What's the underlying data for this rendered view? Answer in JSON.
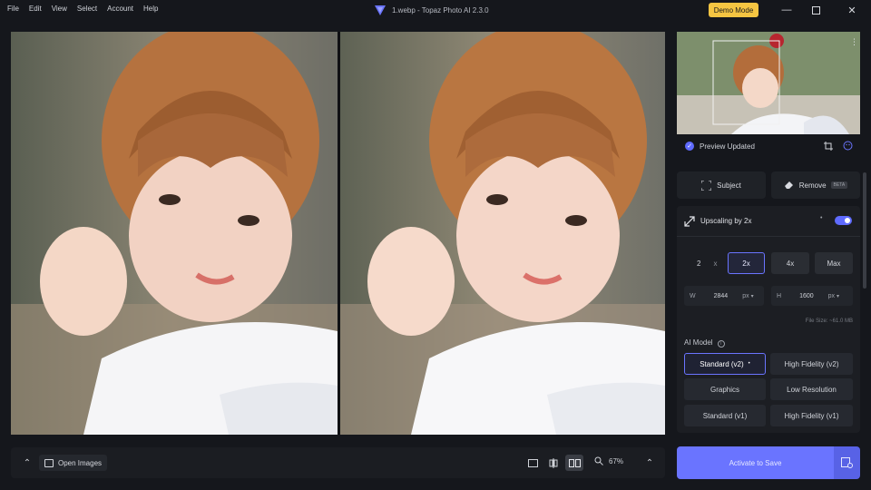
{
  "menu": [
    "File",
    "Edit",
    "View",
    "Select",
    "Account",
    "Help"
  ],
  "window": {
    "title": "1.webp - Topaz Photo AI 2.3.0",
    "demo_badge": "Demo Mode"
  },
  "preview": {
    "status": "Preview Updated"
  },
  "tools": {
    "subject": "Subject",
    "remove": "Remove",
    "remove_badge": "BETA"
  },
  "upscale": {
    "title": "Upscaling by 2x",
    "enabled": true,
    "scale_custom_value": "2",
    "scale_custom_unit": "x",
    "scale_options": [
      "2x",
      "4x",
      "Max"
    ],
    "selected_scale": "2x",
    "width_label": "W",
    "width_value": "2844",
    "height_label": "H",
    "height_value": "1600",
    "unit": "px",
    "file_size": "File Size: ~61.0 MB"
  },
  "ai_model": {
    "label": "AI Model",
    "options": [
      "Standard (v2)",
      "High Fidelity (v2)",
      "Graphics",
      "Low Resolution",
      "Standard (v1)",
      "High Fidelity (v1)"
    ],
    "selected": "Standard (v2)"
  },
  "bottom": {
    "open_images": "Open Images",
    "zoom": "67%"
  },
  "actions": {
    "activate": "Activate to Save"
  },
  "colors": {
    "accent": "#6a74ff",
    "demo": "#f5c542",
    "bg": "#15171c"
  }
}
